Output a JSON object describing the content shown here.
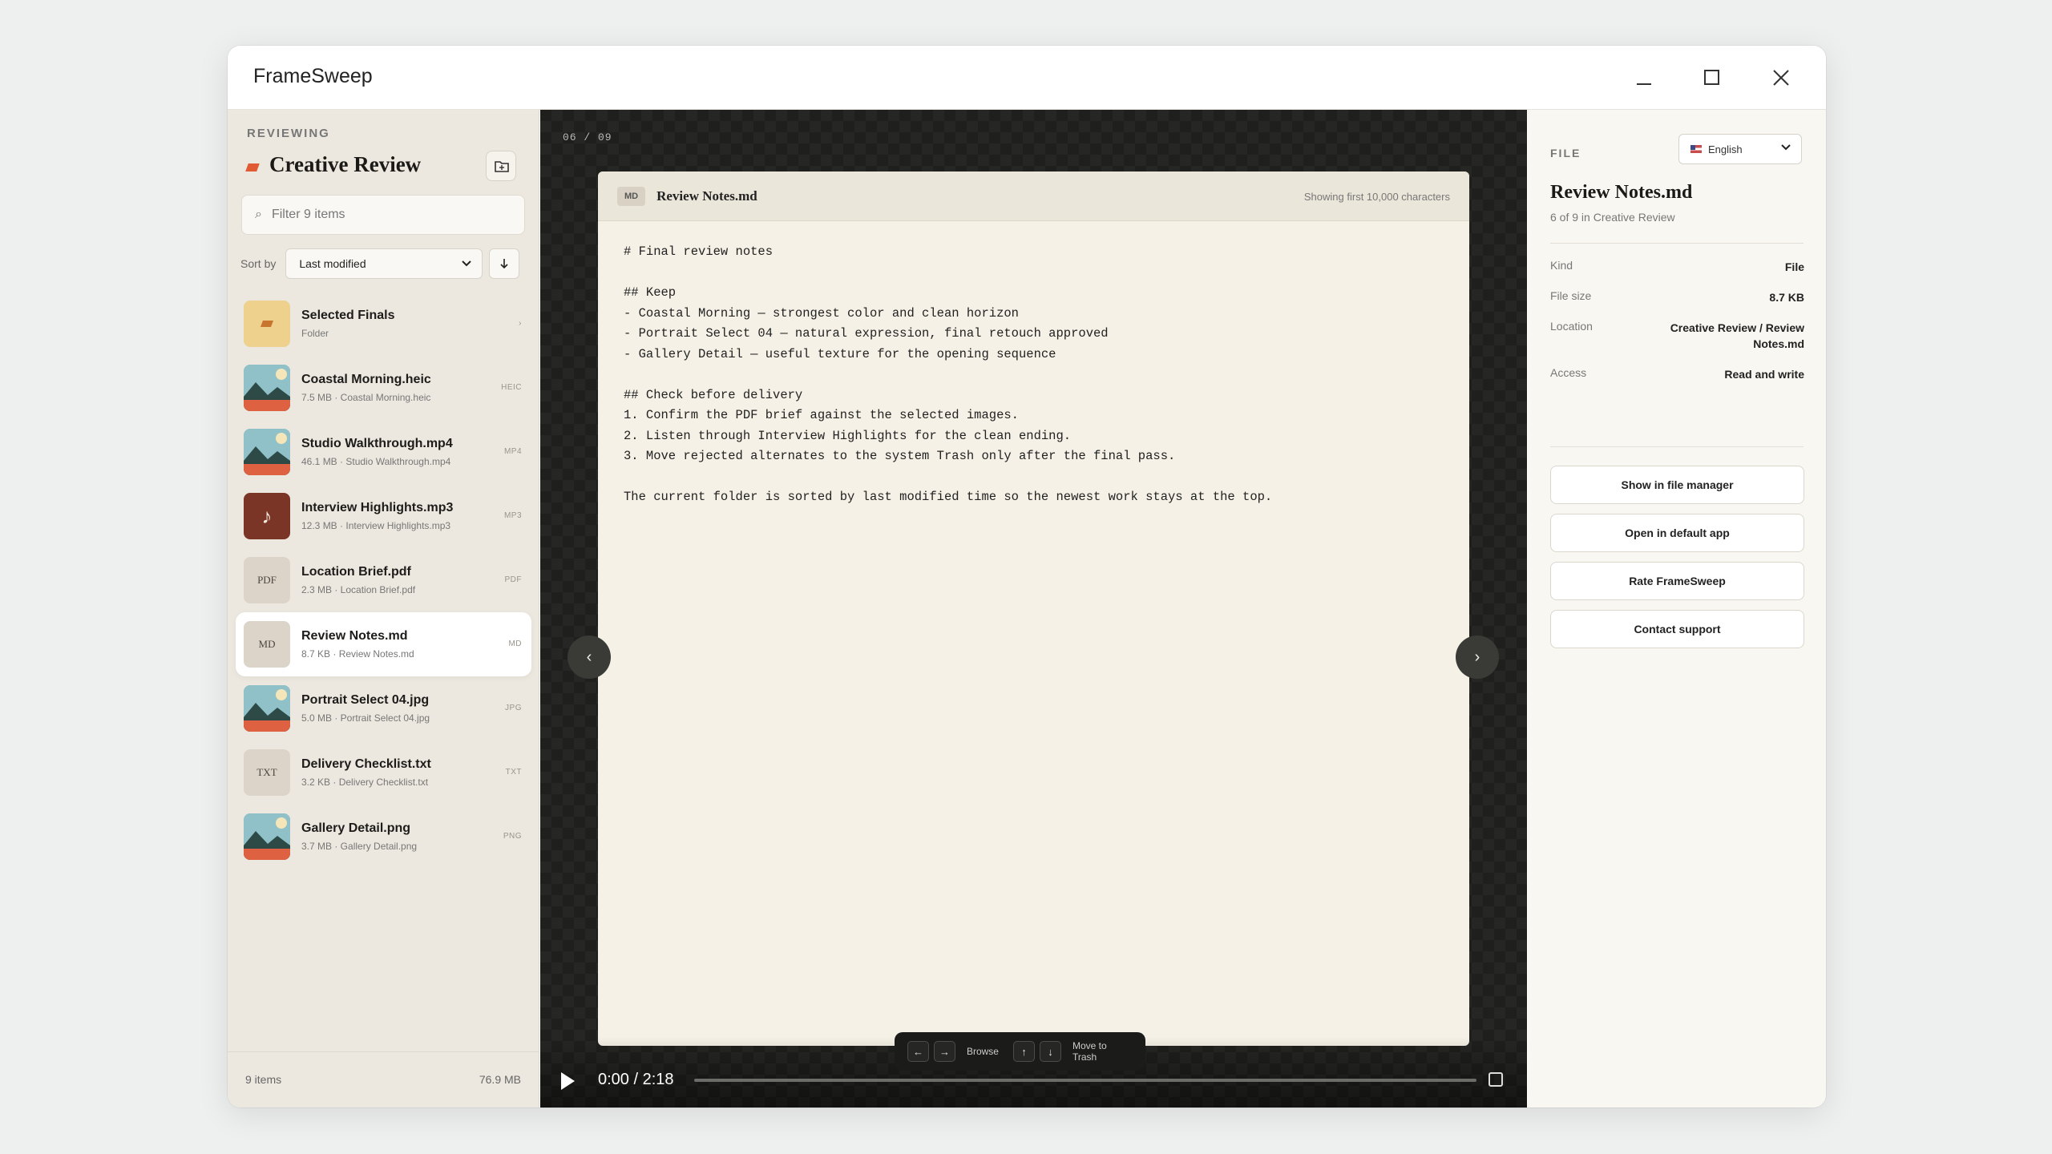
{
  "app": {
    "title": "FrameSweep"
  },
  "sidebar": {
    "label": "REVIEWING",
    "title": "Creative Review",
    "filter_placeholder": "Filter 9 items",
    "sort_label": "Sort by",
    "sort_value": "Last modified",
    "items": [
      {
        "name": "Selected Finals",
        "meta": "Folder",
        "tag": "›",
        "kind": "folder"
      },
      {
        "name": "Coastal Morning.heic",
        "meta": "7.5 MB · Coastal Morning.heic",
        "tag": "HEIC",
        "kind": "img"
      },
      {
        "name": "Studio Walkthrough.mp4",
        "meta": "46.1 MB · Studio Walkthrough.mp4",
        "tag": "MP4",
        "kind": "img"
      },
      {
        "name": "Interview Highlights.mp3",
        "meta": "12.3 MB · Interview Highlights.mp3",
        "tag": "MP3",
        "kind": "audio",
        "glyph": "♪"
      },
      {
        "name": "Location Brief.pdf",
        "meta": "2.3 MB · Location Brief.pdf",
        "tag": "PDF",
        "kind": "doc",
        "glyph": "PDF"
      },
      {
        "name": "Review Notes.md",
        "meta": "8.7 KB · Review Notes.md",
        "tag": "MD",
        "kind": "doc",
        "glyph": "MD"
      },
      {
        "name": "Portrait Select 04.jpg",
        "meta": "5.0 MB · Portrait Select 04.jpg",
        "tag": "JPG",
        "kind": "img"
      },
      {
        "name": "Delivery Checklist.txt",
        "meta": "3.2 KB · Delivery Checklist.txt",
        "tag": "TXT",
        "kind": "doc",
        "glyph": "TXT"
      },
      {
        "name": "Gallery Detail.png",
        "meta": "3.7 MB · Gallery Detail.png",
        "tag": "PNG",
        "kind": "img"
      }
    ],
    "footer_count": "9 items",
    "footer_size": "76.9 MB"
  },
  "viewer": {
    "counter": "06 / 09",
    "doc_badge": "MD",
    "doc_name": "Review Notes.md",
    "doc_note": "Showing first 10,000 characters",
    "doc_text": "# Final review notes\n\n## Keep\n- Coastal Morning — strongest color and clean horizon\n- Portrait Select 04 — natural expression, final retouch approved\n- Gallery Detail — useful texture for the opening sequence\n\n## Check before delivery\n1. Confirm the PDF brief against the selected images.\n2. Listen through Interview Highlights for the clean ending.\n3. Move rejected alternates to the system Trash only after the final pass.\n\nThe current folder is sorted by last modified time so the newest work stays at the top.",
    "prev_glyph": "‹",
    "next_glyph": "›",
    "time": "0:00 / 2:18",
    "hint_browse": "Browse",
    "hint_trash": "Move to Trash",
    "key_left": "←",
    "key_right": "→",
    "key_up": "↑",
    "key_down": "↓"
  },
  "details": {
    "label": "FILE",
    "language": "English",
    "title": "Review Notes.md",
    "subtitle": "6 of 9 in Creative Review",
    "props": [
      {
        "k": "Kind",
        "v": "File"
      },
      {
        "k": "File size",
        "v": "8.7 KB"
      },
      {
        "k": "Location",
        "v": "Creative Review / Review Notes.md"
      },
      {
        "k": "Access",
        "v": "Read and write"
      }
    ],
    "actions": [
      "Show in file manager",
      "Open in default app",
      "Rate FrameSweep",
      "Contact support"
    ]
  },
  "colors": {
    "accent": "#e05b33",
    "sidebar_bg": "#ece8df",
    "viewer_bg": "#1f1f1d",
    "paper": "#f5f1e6"
  }
}
